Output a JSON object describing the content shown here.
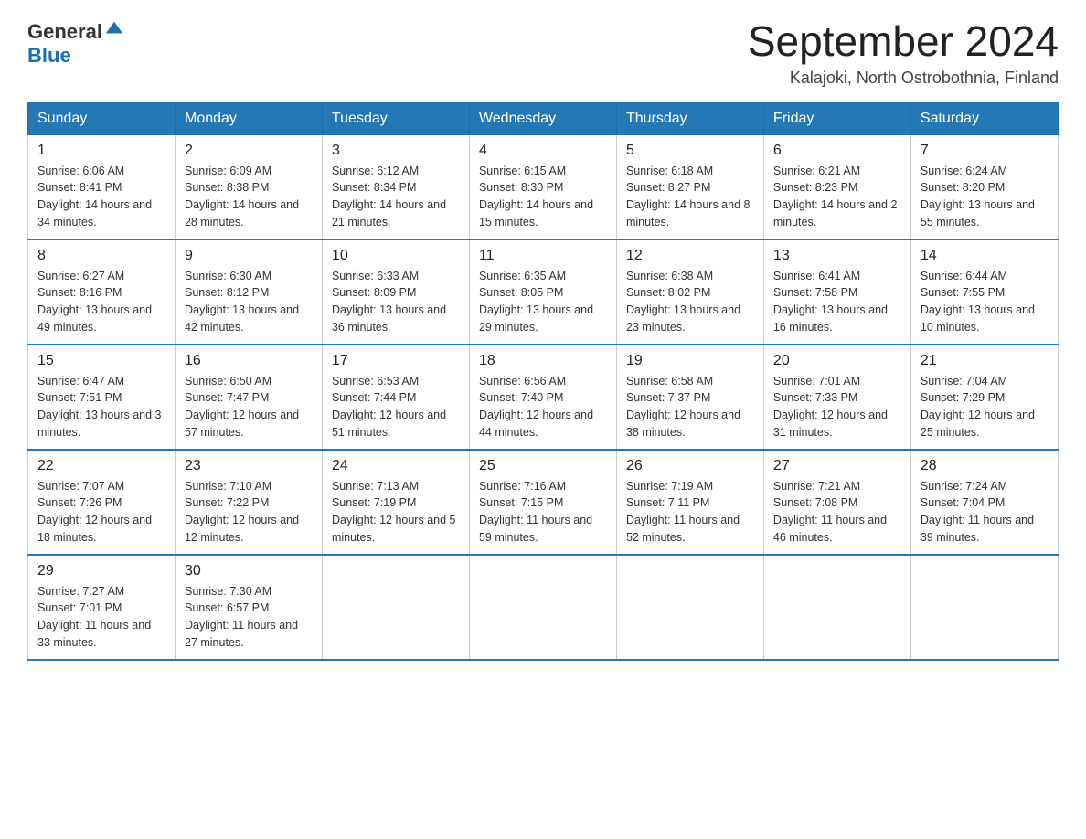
{
  "header": {
    "logo_general": "General",
    "logo_blue": "Blue",
    "title": "September 2024",
    "subtitle": "Kalajoki, North Ostrobothnia, Finland"
  },
  "days_of_week": [
    "Sunday",
    "Monday",
    "Tuesday",
    "Wednesday",
    "Thursday",
    "Friday",
    "Saturday"
  ],
  "weeks": [
    [
      {
        "day": "1",
        "sunrise": "6:06 AM",
        "sunset": "8:41 PM",
        "daylight": "14 hours and 34 minutes."
      },
      {
        "day": "2",
        "sunrise": "6:09 AM",
        "sunset": "8:38 PM",
        "daylight": "14 hours and 28 minutes."
      },
      {
        "day": "3",
        "sunrise": "6:12 AM",
        "sunset": "8:34 PM",
        "daylight": "14 hours and 21 minutes."
      },
      {
        "day": "4",
        "sunrise": "6:15 AM",
        "sunset": "8:30 PM",
        "daylight": "14 hours and 15 minutes."
      },
      {
        "day": "5",
        "sunrise": "6:18 AM",
        "sunset": "8:27 PM",
        "daylight": "14 hours and 8 minutes."
      },
      {
        "day": "6",
        "sunrise": "6:21 AM",
        "sunset": "8:23 PM",
        "daylight": "14 hours and 2 minutes."
      },
      {
        "day": "7",
        "sunrise": "6:24 AM",
        "sunset": "8:20 PM",
        "daylight": "13 hours and 55 minutes."
      }
    ],
    [
      {
        "day": "8",
        "sunrise": "6:27 AM",
        "sunset": "8:16 PM",
        "daylight": "13 hours and 49 minutes."
      },
      {
        "day": "9",
        "sunrise": "6:30 AM",
        "sunset": "8:12 PM",
        "daylight": "13 hours and 42 minutes."
      },
      {
        "day": "10",
        "sunrise": "6:33 AM",
        "sunset": "8:09 PM",
        "daylight": "13 hours and 36 minutes."
      },
      {
        "day": "11",
        "sunrise": "6:35 AM",
        "sunset": "8:05 PM",
        "daylight": "13 hours and 29 minutes."
      },
      {
        "day": "12",
        "sunrise": "6:38 AM",
        "sunset": "8:02 PM",
        "daylight": "13 hours and 23 minutes."
      },
      {
        "day": "13",
        "sunrise": "6:41 AM",
        "sunset": "7:58 PM",
        "daylight": "13 hours and 16 minutes."
      },
      {
        "day": "14",
        "sunrise": "6:44 AM",
        "sunset": "7:55 PM",
        "daylight": "13 hours and 10 minutes."
      }
    ],
    [
      {
        "day": "15",
        "sunrise": "6:47 AM",
        "sunset": "7:51 PM",
        "daylight": "13 hours and 3 minutes."
      },
      {
        "day": "16",
        "sunrise": "6:50 AM",
        "sunset": "7:47 PM",
        "daylight": "12 hours and 57 minutes."
      },
      {
        "day": "17",
        "sunrise": "6:53 AM",
        "sunset": "7:44 PM",
        "daylight": "12 hours and 51 minutes."
      },
      {
        "day": "18",
        "sunrise": "6:56 AM",
        "sunset": "7:40 PM",
        "daylight": "12 hours and 44 minutes."
      },
      {
        "day": "19",
        "sunrise": "6:58 AM",
        "sunset": "7:37 PM",
        "daylight": "12 hours and 38 minutes."
      },
      {
        "day": "20",
        "sunrise": "7:01 AM",
        "sunset": "7:33 PM",
        "daylight": "12 hours and 31 minutes."
      },
      {
        "day": "21",
        "sunrise": "7:04 AM",
        "sunset": "7:29 PM",
        "daylight": "12 hours and 25 minutes."
      }
    ],
    [
      {
        "day": "22",
        "sunrise": "7:07 AM",
        "sunset": "7:26 PM",
        "daylight": "12 hours and 18 minutes."
      },
      {
        "day": "23",
        "sunrise": "7:10 AM",
        "sunset": "7:22 PM",
        "daylight": "12 hours and 12 minutes."
      },
      {
        "day": "24",
        "sunrise": "7:13 AM",
        "sunset": "7:19 PM",
        "daylight": "12 hours and 5 minutes."
      },
      {
        "day": "25",
        "sunrise": "7:16 AM",
        "sunset": "7:15 PM",
        "daylight": "11 hours and 59 minutes."
      },
      {
        "day": "26",
        "sunrise": "7:19 AM",
        "sunset": "7:11 PM",
        "daylight": "11 hours and 52 minutes."
      },
      {
        "day": "27",
        "sunrise": "7:21 AM",
        "sunset": "7:08 PM",
        "daylight": "11 hours and 46 minutes."
      },
      {
        "day": "28",
        "sunrise": "7:24 AM",
        "sunset": "7:04 PM",
        "daylight": "11 hours and 39 minutes."
      }
    ],
    [
      {
        "day": "29",
        "sunrise": "7:27 AM",
        "sunset": "7:01 PM",
        "daylight": "11 hours and 33 minutes."
      },
      {
        "day": "30",
        "sunrise": "7:30 AM",
        "sunset": "6:57 PM",
        "daylight": "11 hours and 27 minutes."
      },
      null,
      null,
      null,
      null,
      null
    ]
  ],
  "labels": {
    "sunrise": "Sunrise:",
    "sunset": "Sunset:",
    "daylight": "Daylight:"
  }
}
